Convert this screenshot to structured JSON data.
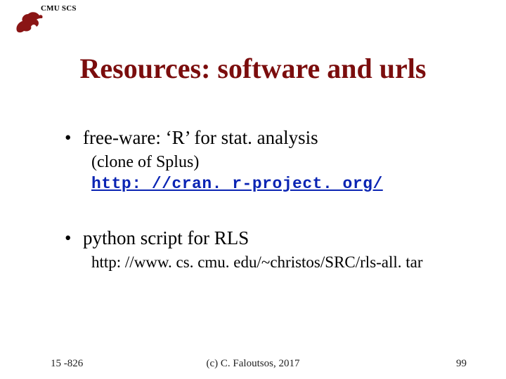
{
  "header": {
    "label": "CMU SCS"
  },
  "title": "Resources: software and urls",
  "items": [
    {
      "bullet": "free-ware: ‘R’ for stat. analysis",
      "sub": "(clone of Splus)",
      "url": "http: //cran. r-project. org/",
      "url_style": "link"
    },
    {
      "bullet": "python script for RLS",
      "url": "http: //www. cs. cmu. edu/~christos/SRC/rls-all. tar",
      "url_style": "plain"
    }
  ],
  "footer": {
    "left": "15 -826",
    "center": "(c) C. Faloutsos, 2017",
    "right": "99"
  }
}
